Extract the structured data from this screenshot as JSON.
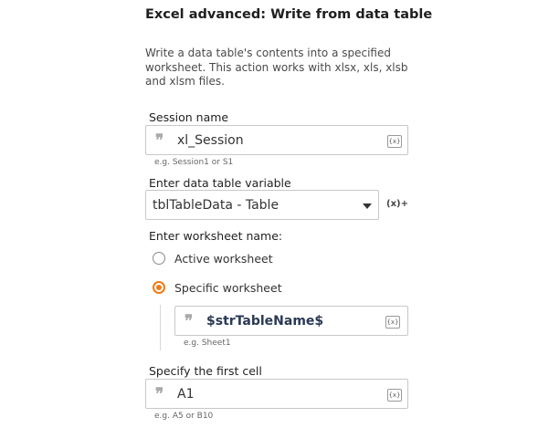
{
  "header": {
    "title": "Excel advanced: Write from data table",
    "description": "Write a data table's contents into a specified worksheet. This action works with xlsx, xls, xlsb and xlsm files."
  },
  "session": {
    "label": "Session name",
    "value": "xl_Session",
    "hint": "e.g. Session1 or S1",
    "var_icon": "{x}"
  },
  "datatable": {
    "label": "Enter data table variable",
    "selected": "tblTableData - Table",
    "var_icon": "(x)+"
  },
  "worksheet": {
    "label": "Enter worksheet name:",
    "options": [
      {
        "label": "Active worksheet",
        "checked": false
      },
      {
        "label": "Specific worksheet",
        "checked": true
      }
    ],
    "value": "$strTableName$",
    "hint": "e.g. Sheet1",
    "var_icon": "{x}"
  },
  "first_cell": {
    "label": "Specify the first cell",
    "value": "A1",
    "hint": "e.g. A5 or B10",
    "var_icon": "{x}"
  },
  "colors": {
    "accent": "#f07b16",
    "border": "#c8c8c8"
  }
}
